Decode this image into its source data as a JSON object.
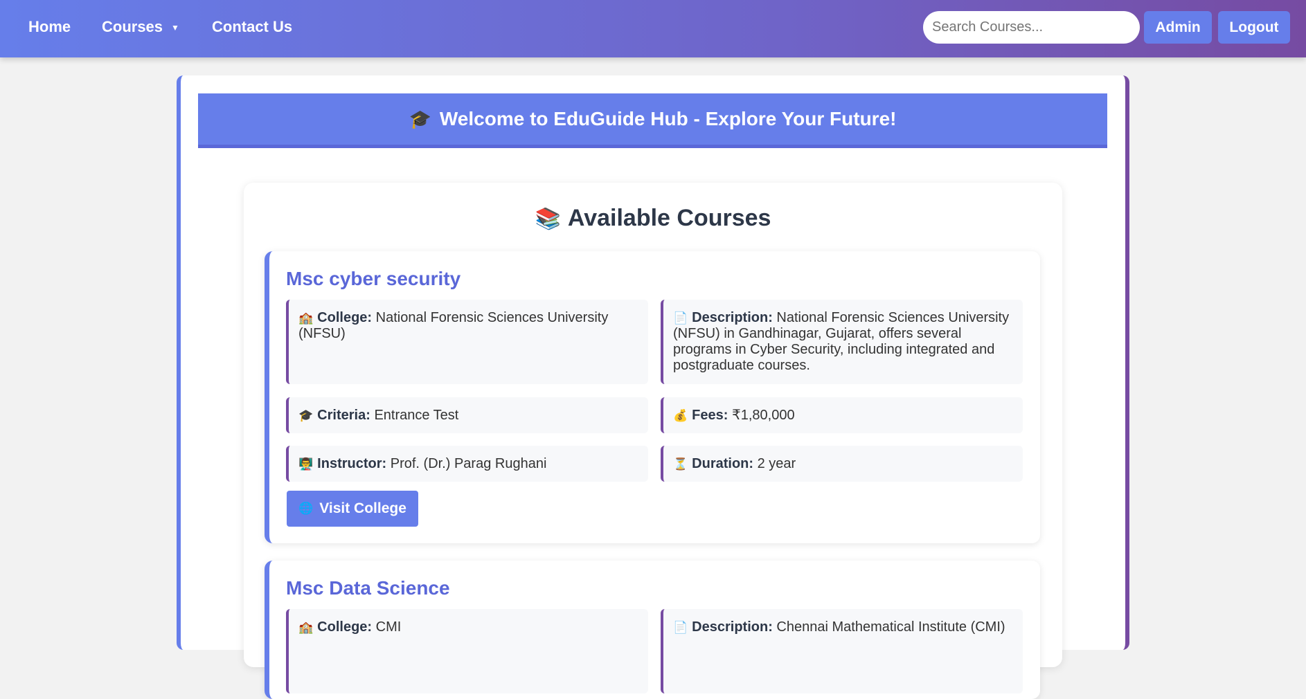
{
  "nav": {
    "home": "Home",
    "courses": "Courses",
    "contact": "Contact Us",
    "search_placeholder": "Search Courses...",
    "admin": "Admin",
    "logout": "Logout"
  },
  "banner": {
    "emoji": "🎓",
    "text": "Welcome to EduGuide Hub - Explore Your Future!"
  },
  "section": {
    "emoji": "📚",
    "title": "Available Courses"
  },
  "courses": [
    {
      "title": "Msc cyber security",
      "college_label": "College:",
      "college": "National Forensic Sciences University (NFSU)",
      "description_label": "Description:",
      "description": "National Forensic Sciences University (NFSU) in Gandhinagar, Gujarat, offers several programs in Cyber Security, including integrated and postgraduate courses.",
      "criteria_label": "Criteria:",
      "criteria": "Entrance Test",
      "fees_label": "Fees:",
      "fees": "₹1,80,000",
      "instructor_label": "Instructor:",
      "instructor": "Prof. (Dr.) Parag Rughani",
      "duration_label": "Duration:",
      "duration": "2 year",
      "visit_label": "Visit College"
    },
    {
      "title": "Msc Data Science",
      "college_label": "College:",
      "college": "CMI",
      "description_label": "Description:",
      "description": "Chennai Mathematical Institute (CMI)"
    }
  ],
  "icons": {
    "college": "🏫",
    "description": "📄",
    "criteria": "🎓",
    "fees": "💰",
    "instructor": "👨‍🏫",
    "duration": "⏳",
    "visit": "🌐"
  }
}
